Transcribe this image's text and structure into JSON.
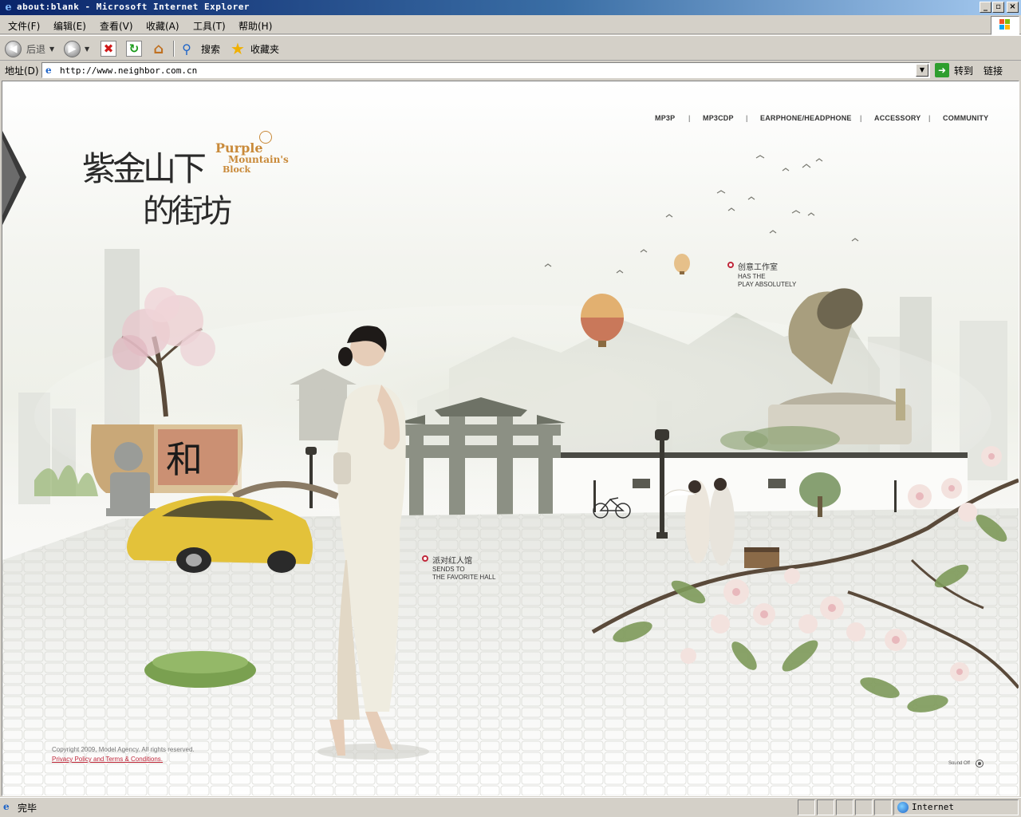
{
  "window": {
    "title": "about:blank - Microsoft Internet Explorer",
    "buttons": {
      "minimize": "_",
      "maximize": "▫",
      "close": "×"
    }
  },
  "menu": [
    "文件(F)",
    "编辑(E)",
    "查看(V)",
    "收藏(A)",
    "工具(T)",
    "帮助(H)"
  ],
  "toolbar": {
    "back": "后退",
    "search": "搜索",
    "favorites": "收藏夹"
  },
  "address": {
    "label": "地址(D)",
    "url": "http://www.neighbor.com.cn",
    "go": "转到",
    "links": "链接"
  },
  "page": {
    "nav": [
      "MP3P",
      "MP3CDP",
      "EARPHONE/HEADPHONE",
      "ACCESSORY",
      "COMMUNITY"
    ],
    "nav_separator": "|",
    "logo": {
      "cn_line1": "紫金山下",
      "cn_line2": "的街坊",
      "en_line1": "Purple",
      "en_line2": "Mountain's",
      "en_line3": "Block"
    },
    "hotspots": [
      {
        "cn": "创意工作室",
        "en1": "HAS THE",
        "en2": "PLAY ABSOLUTELY"
      },
      {
        "cn": "派对红人馆",
        "en1": "SENDS TO",
        "en2": "THE FAVORITE HALL"
      }
    ],
    "copyright": "Copyright 2009, Model Agency. All rights reserved.",
    "policy_link": "Privacy Policy and Terms & Conditions.",
    "sound": "Sound Off"
  },
  "status": {
    "text": "完毕",
    "zone": "Internet"
  },
  "colors": {
    "title_bar_start": "#0a246a",
    "title_bar_end": "#a6caf0",
    "chrome": "#d4d0c8",
    "accent_red": "#c0283b",
    "logo_gold": "#c98a3a"
  }
}
